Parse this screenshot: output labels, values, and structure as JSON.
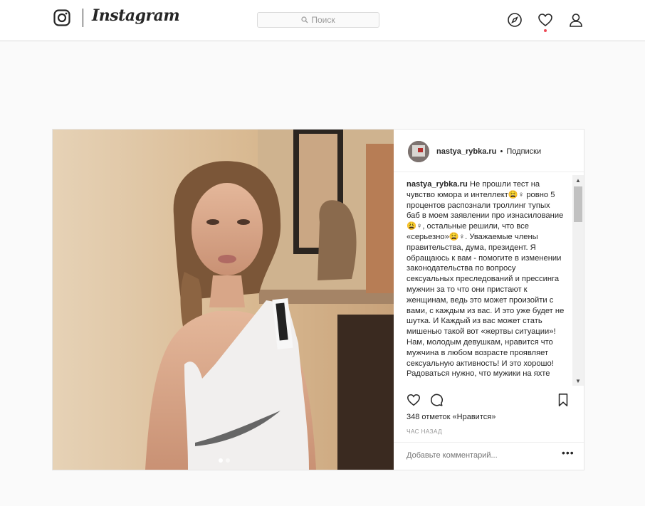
{
  "nav": {
    "brand": "Instagram",
    "search_placeholder": "Поиск",
    "icons": [
      "instagram-glyph-icon",
      "search-icon",
      "compass-icon",
      "heart-icon",
      "profile-icon"
    ],
    "notification_dot_color": "#ed4956"
  },
  "post": {
    "username": "nastya_rybka.ru",
    "separator": "•",
    "follow_label": "Подписки",
    "caption_user": "nastya_rybka.ru",
    "caption_text": " Не прошли тест на чувство юмора и интеллект😩♀ ровно 5 процентов распознали троллинг тупых баб в моем заявлении про изнасилование😩♀, остальные решили, что все «серьезно»😩♀. Уважаемые члены правительства, дума, президент. Я обращаюсь к вам - помогите в изменении законодательства по вопросу сексуальных преследований и прессинга мужчин за то что они пристают к женщинам, ведь это может произойти с вами, с каждым из вас. И это уже будет не шутка. И Каждый из вас может стать мишенью такой вот «жертвы ситуации»! Нам, молодым девушкам, нравится что мужчина в любом возрасте проявляет сексуальную активность! И это хорошо! Радоваться нужно, что мужики на яхте",
    "likes_text": "348 отметок «Нравится»",
    "time_text": "ЧАС НАЗАД",
    "comment_placeholder": "Добавьте комментарий...",
    "more_label": "•••",
    "carousel": {
      "count": 2,
      "active_index": 0
    },
    "icons": [
      "heart-outline-icon",
      "comment-icon",
      "bookmark-icon",
      "more-options-icon"
    ]
  },
  "scrollbar": {
    "up": "▲",
    "down": "▼"
  }
}
